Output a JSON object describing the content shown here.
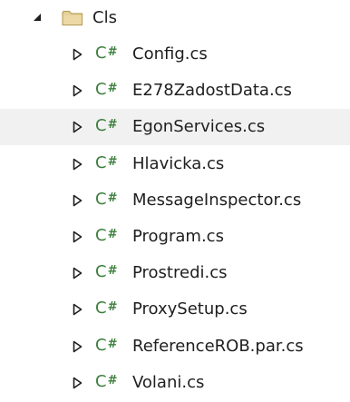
{
  "colors": {
    "csharp_icon": "#3d7f3d",
    "folder_fill": "#e7d29a",
    "folder_stroke": "#b8a15a",
    "selection": "#f1f1f1",
    "expander": "#1e1e1e"
  },
  "tree": {
    "folder": {
      "label": "Cls",
      "icon": "folder-icon",
      "expander_icon": "expanded-triangle-icon",
      "expanded": true
    },
    "file_icon_text": "C",
    "file_icon_hash": "#",
    "files": [
      {
        "label": "Config.cs",
        "selected": false
      },
      {
        "label": "E278ZadostData.cs",
        "selected": false
      },
      {
        "label": "EgonServices.cs",
        "selected": true
      },
      {
        "label": "Hlavicka.cs",
        "selected": false
      },
      {
        "label": "MessageInspector.cs",
        "selected": false
      },
      {
        "label": "Program.cs",
        "selected": false
      },
      {
        "label": "Prostredi.cs",
        "selected": false
      },
      {
        "label": "ProxySetup.cs",
        "selected": false
      },
      {
        "label": "ReferenceROB.par.cs",
        "selected": false
      },
      {
        "label": "Volani.cs",
        "selected": false
      }
    ]
  }
}
